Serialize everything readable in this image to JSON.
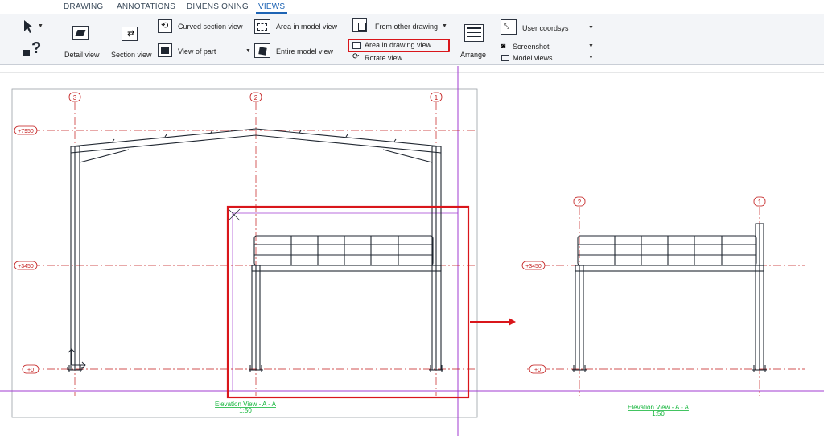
{
  "tabs": [
    {
      "label": "DRAWING",
      "active": false
    },
    {
      "label": "ANNOTATIONS",
      "active": false
    },
    {
      "label": "DIMENSIONING",
      "active": false
    },
    {
      "label": "VIEWS",
      "active": true
    }
  ],
  "ribbon": {
    "detail_view": "Detail view",
    "section_view": "Section view",
    "curved_section_view": "Curved section view",
    "view_of_part": "View of part",
    "area_in_model_view": "Area in model view",
    "entire_model_view": "Entire model view",
    "from_other_drawing": "From other drawing",
    "area_in_drawing_view": "Area in drawing view",
    "rotate_view": "Rotate view",
    "arrange": "Arrange",
    "user_coordsys": "User coordsys",
    "screenshot": "Screenshot",
    "model_views": "Model views"
  },
  "drawing": {
    "main_view": {
      "grid_labels": [
        "3",
        "2",
        "1"
      ],
      "levels": [
        "+7950",
        "+3450",
        "+0"
      ],
      "title": "Elevation View - A - A",
      "subtitle": "1:50"
    },
    "new_view": {
      "grid_labels": [
        "2",
        "1"
      ],
      "levels": [
        "+3450",
        "+0"
      ],
      "title": "Elevation View - A - A",
      "subtitle": "1:50"
    }
  },
  "colors": {
    "accent": "#1e64b4",
    "highlight": "#d9161b",
    "grid_line": "#c21a1a",
    "view_title": "#13b53a",
    "guide_line": "#a23bd1"
  }
}
